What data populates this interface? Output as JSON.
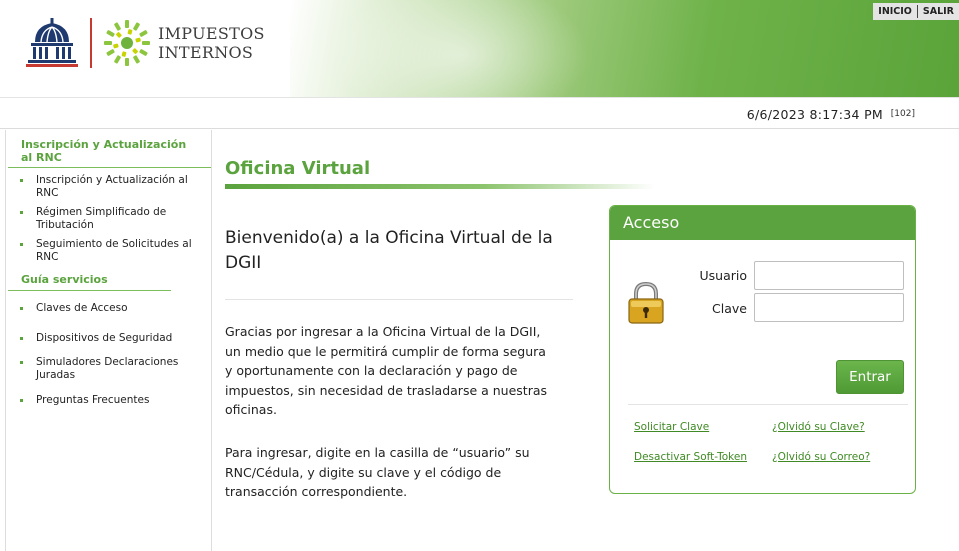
{
  "brand": {
    "line1": "IMPUESTOS",
    "line2": "INTERNOS"
  },
  "topnav": {
    "inicio": "INICIO",
    "salir": "SALIR"
  },
  "datebar": {
    "datetime": "6/6/2023 8:17:34 PM",
    "code": "[102]"
  },
  "sidebar": {
    "section1": {
      "title_line1": "Inscripción y Actualización",
      "title_line2": "al RNC",
      "items": [
        {
          "line1": "Inscripción y Actualización al",
          "line2": "RNC"
        },
        {
          "line1": "Régimen Simplificado de",
          "line2": "Tributación"
        },
        {
          "line1": "Seguimiento de Solicitudes al",
          "line2": "RNC"
        }
      ]
    },
    "section2": {
      "title": "Guía servicios",
      "items": [
        {
          "line1": "Claves de Acceso",
          "line2": ""
        },
        {
          "line1": "Dispositivos de Seguridad",
          "line2": ""
        },
        {
          "line1": "Simuladores Declaraciones",
          "line2": "Juradas"
        },
        {
          "line1": "Preguntas Frecuentes",
          "line2": ""
        }
      ]
    }
  },
  "main": {
    "title": "Oficina Virtual",
    "welcome_line1": "Bienvenido(a) a la Oficina Virtual de la",
    "welcome_line2": "DGII",
    "para1": [
      "Gracias por ingresar a la Oficina Virtual de la DGII,",
      "un medio que le permitirá cumplir de forma segura",
      "y oportunamente con la declaración y pago de",
      "impuestos, sin necesidad de trasladarse a nuestras",
      "oficinas."
    ],
    "para2": [
      "Para ingresar, digite en la casilla de “usuario” su",
      "RNC/Cédula, y digite su clave y el código de",
      "transacción correspondiente."
    ]
  },
  "login": {
    "title": "Acceso",
    "user_label": "Usuario",
    "user_value": "",
    "pass_label": "Clave",
    "pass_value": "",
    "submit": "Entrar",
    "links": {
      "solicitar": "Solicitar Clave",
      "olvido_clave": "¿Olvidó su Clave?",
      "desactivar": "Desactivar Soft-Token",
      "olvido_correo": "¿Olvidó su Correo?"
    }
  },
  "colors": {
    "brand_green": "#5ba33e",
    "link_green": "#3f8a24",
    "logo_red": "#c63a32",
    "logo_navy": "#1e3a6e"
  }
}
